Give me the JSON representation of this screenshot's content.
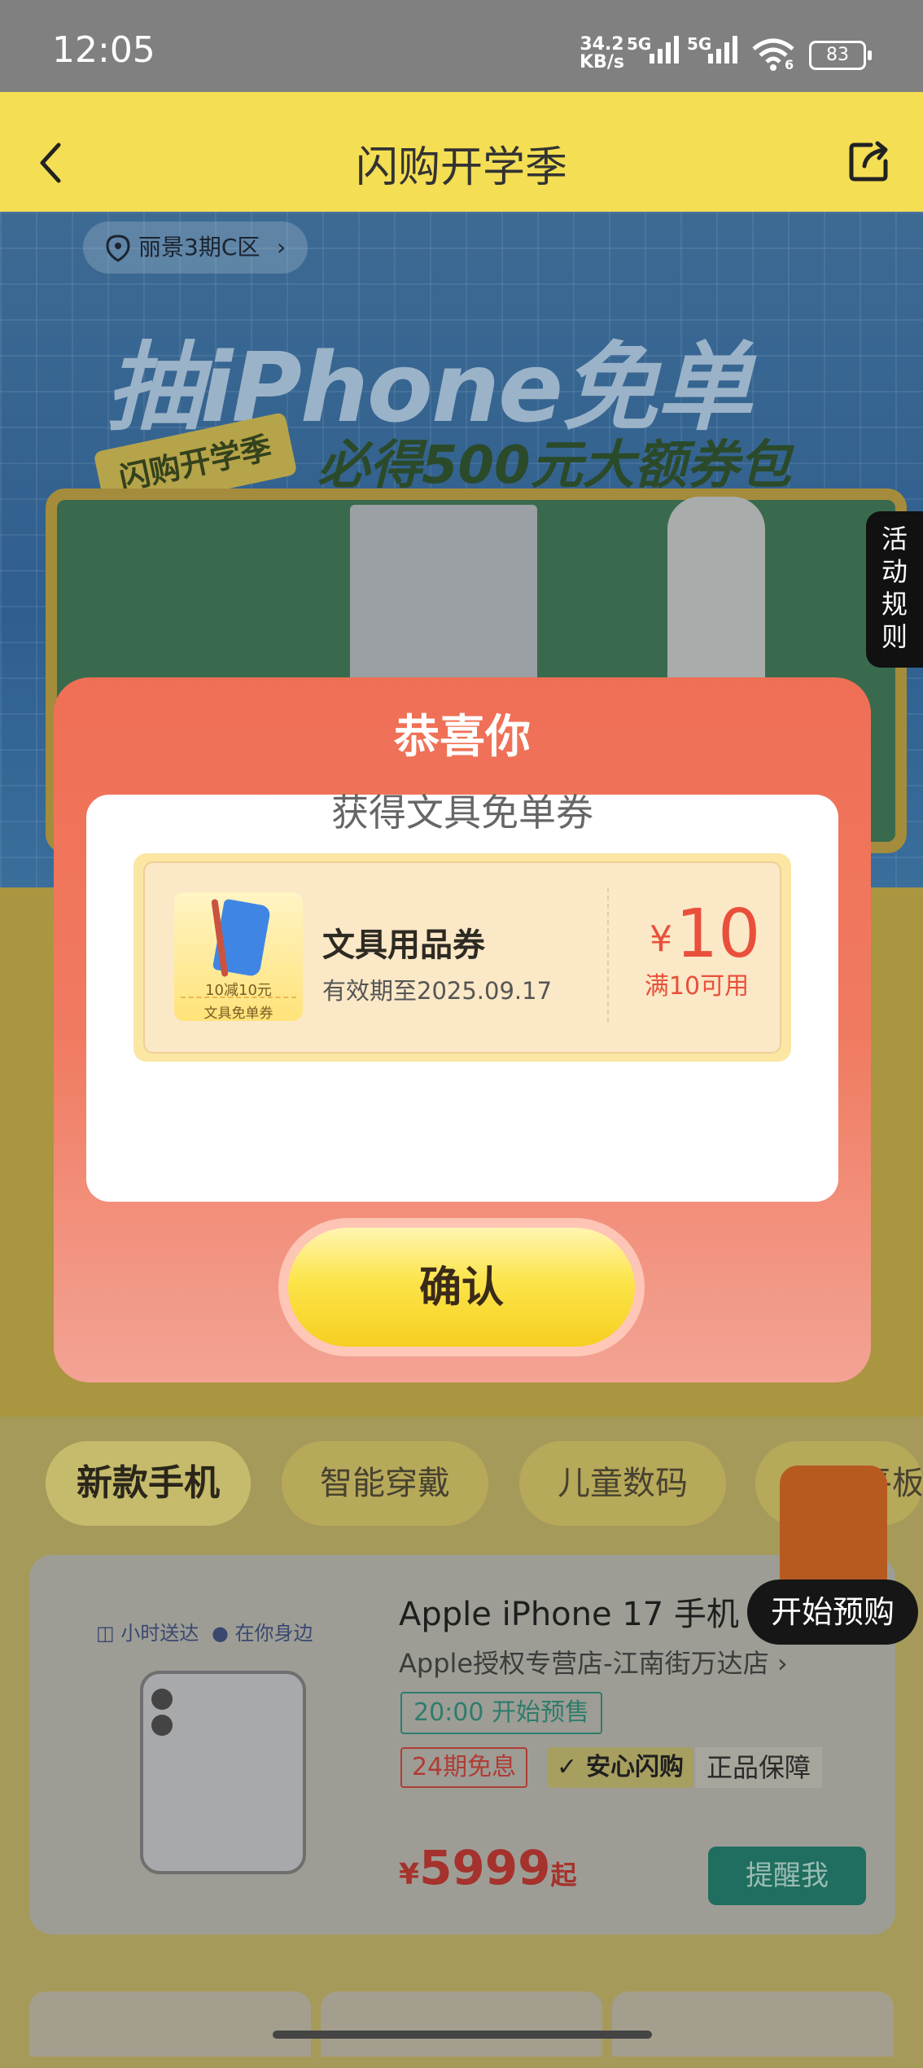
{
  "status_bar": {
    "time": "12:05",
    "net_speed": "34.2",
    "net_unit": "KB/s",
    "sim1": "5G",
    "sim2": "5G",
    "wifi_badge": "6",
    "battery": "83"
  },
  "header": {
    "title": "闪购开学季",
    "back_icon": "chevron-left-icon",
    "share_icon": "share-icon"
  },
  "hero": {
    "location": "丽景3期C区",
    "headline": "抽iPhone免单",
    "subline": "必得500元大额券包",
    "tag": "闪购开学季",
    "rules": [
      "活",
      "动",
      "规",
      "则"
    ]
  },
  "modal": {
    "title": "恭喜你",
    "subtitle": "获得文具免单券",
    "coupon": {
      "thumb_line1": "10减10元",
      "thumb_line2": "文具免单券",
      "name": "文具用品券",
      "expiry": "有效期至2025.09.17",
      "currency": "¥",
      "amount": "10",
      "condition": "满10可用"
    },
    "confirm_label": "确认"
  },
  "tabs": [
    {
      "label": "新款手机",
      "active": true
    },
    {
      "label": "智能穿戴",
      "active": false
    },
    {
      "label": "儿童数码",
      "active": false
    },
    {
      "label": "平板",
      "active": false
    }
  ],
  "product": {
    "delivery_left": "小时送达",
    "delivery_right": "在你身边",
    "title": "Apple iPhone 17 手机",
    "store": "Apple授权专营店-江南街万达店",
    "presale": "20:00 开始预售",
    "tag_installment": "24期免息",
    "tag_safe": "安心闪购",
    "tag_genuine": "正品保障",
    "price_currency": "¥",
    "price": "5999",
    "price_suffix": "起",
    "remind_label": "提醒我"
  },
  "float_button": {
    "label": "开始预购"
  },
  "colors": {
    "header_bg": "#f4de54",
    "modal_top": "#ef6f55",
    "confirm": "#fce44a",
    "coupon_red": "#e9503b"
  }
}
